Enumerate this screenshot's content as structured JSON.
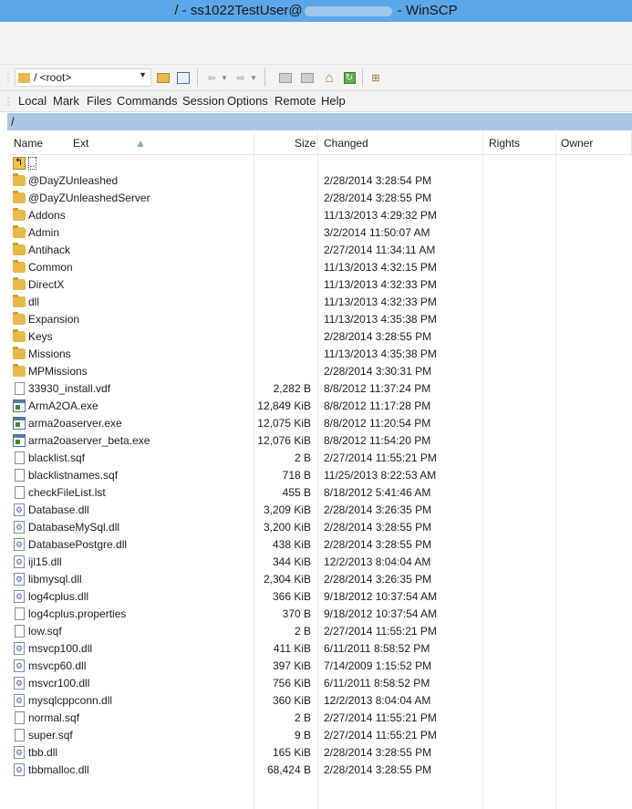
{
  "window": {
    "title_prefix": "/ - ss1022TestUser@",
    "title_suffix": " - WinSCP"
  },
  "address": {
    "path": "/ <root>"
  },
  "menu": [
    "Local",
    "Mark",
    "Files",
    "Commands",
    "Session",
    "Options",
    "Remote",
    "Help"
  ],
  "current_path": "/",
  "columns": {
    "name": "Name",
    "ext": "Ext",
    "size": "Size",
    "changed": "Changed",
    "rights": "Rights",
    "owner": "Owner"
  },
  "files": [
    {
      "name": "..",
      "type": "up",
      "size": "",
      "changed": ""
    },
    {
      "name": "@DayZUnleashed",
      "type": "folder",
      "size": "",
      "changed": "2/28/2014 3:28:54 PM"
    },
    {
      "name": "@DayZUnleashedServer",
      "type": "folder",
      "size": "",
      "changed": "2/28/2014 3:28:55 PM"
    },
    {
      "name": "Addons",
      "type": "folder",
      "size": "",
      "changed": "11/13/2013 4:29:32 PM"
    },
    {
      "name": "Admin",
      "type": "folder",
      "size": "",
      "changed": "3/2/2014 11:50:07 AM"
    },
    {
      "name": "Antihack",
      "type": "folder",
      "size": "",
      "changed": "2/27/2014 11:34:11 AM"
    },
    {
      "name": "Common",
      "type": "folder",
      "size": "",
      "changed": "11/13/2013 4:32:15 PM"
    },
    {
      "name": "DirectX",
      "type": "folder",
      "size": "",
      "changed": "11/13/2013 4:32:33 PM"
    },
    {
      "name": "dll",
      "type": "folder",
      "size": "",
      "changed": "11/13/2013 4:32:33 PM"
    },
    {
      "name": "Expansion",
      "type": "folder",
      "size": "",
      "changed": "11/13/2013 4:35:38 PM"
    },
    {
      "name": "Keys",
      "type": "folder",
      "size": "",
      "changed": "2/28/2014 3:28:55 PM"
    },
    {
      "name": "Missions",
      "type": "folder",
      "size": "",
      "changed": "11/13/2013 4:35:38 PM"
    },
    {
      "name": "MPMissions",
      "type": "folder",
      "size": "",
      "changed": "2/28/2014 3:30:31 PM"
    },
    {
      "name": "33930_install.vdf",
      "type": "file",
      "size": "2,282 B",
      "changed": "8/8/2012 11:37:24 PM"
    },
    {
      "name": "ArmA2OA.exe",
      "type": "exe",
      "size": "12,849 KiB",
      "changed": "8/8/2012 11:17:28 PM"
    },
    {
      "name": "arma2oaserver.exe",
      "type": "exe",
      "size": "12,075 KiB",
      "changed": "8/8/2012 11:20:54 PM"
    },
    {
      "name": "arma2oaserver_beta.exe",
      "type": "exe",
      "size": "12,076 KiB",
      "changed": "8/8/2012 11:54:20 PM"
    },
    {
      "name": "blacklist.sqf",
      "type": "file",
      "size": "2 B",
      "changed": "2/27/2014 11:55:21 PM"
    },
    {
      "name": "blacklistnames.sqf",
      "type": "file",
      "size": "718 B",
      "changed": "11/25/2013 8:22:53 AM"
    },
    {
      "name": "checkFileList.lst",
      "type": "file",
      "size": "455 B",
      "changed": "8/18/2012 5:41:46 AM"
    },
    {
      "name": "Database.dll",
      "type": "dll",
      "size": "3,209 KiB",
      "changed": "2/28/2014 3:26:35 PM"
    },
    {
      "name": "DatabaseMySql.dll",
      "type": "dll",
      "size": "3,200 KiB",
      "changed": "2/28/2014 3:28:55 PM"
    },
    {
      "name": "DatabasePostgre.dll",
      "type": "dll",
      "size": "438 KiB",
      "changed": "2/28/2014 3:28:55 PM"
    },
    {
      "name": "ijl15.dll",
      "type": "dll",
      "size": "344 KiB",
      "changed": "12/2/2013 8:04:04 AM"
    },
    {
      "name": "libmysql.dll",
      "type": "dll",
      "size": "2,304 KiB",
      "changed": "2/28/2014 3:26:35 PM"
    },
    {
      "name": "log4cplus.dll",
      "type": "dll",
      "size": "366 KiB",
      "changed": "9/18/2012 10:37:54 AM"
    },
    {
      "name": "log4cplus.properties",
      "type": "file",
      "size": "370 B",
      "changed": "9/18/2012 10:37:54 AM"
    },
    {
      "name": "low.sqf",
      "type": "file",
      "size": "2 B",
      "changed": "2/27/2014 11:55:21 PM"
    },
    {
      "name": "msvcp100.dll",
      "type": "dll",
      "size": "411 KiB",
      "changed": "6/11/2011 8:58:52 PM"
    },
    {
      "name": "msvcp60.dll",
      "type": "dll",
      "size": "397 KiB",
      "changed": "7/14/2009 1:15:52 PM"
    },
    {
      "name": "msvcr100.dll",
      "type": "dll",
      "size": "756 KiB",
      "changed": "6/11/2011 8:58:52 PM"
    },
    {
      "name": "mysqlcppconn.dll",
      "type": "dll",
      "size": "360 KiB",
      "changed": "12/2/2013 8:04:04 AM"
    },
    {
      "name": "normal.sqf",
      "type": "file",
      "size": "2 B",
      "changed": "2/27/2014 11:55:21 PM"
    },
    {
      "name": "super.sqf",
      "type": "file",
      "size": "9 B",
      "changed": "2/27/2014 11:55:21 PM"
    },
    {
      "name": "tbb.dll",
      "type": "dll",
      "size": "165 KiB",
      "changed": "2/28/2014 3:28:55 PM"
    },
    {
      "name": "tbbmalloc.dll",
      "type": "dll",
      "size": "68,424 B",
      "changed": "2/28/2014 3:28:55 PM"
    }
  ]
}
